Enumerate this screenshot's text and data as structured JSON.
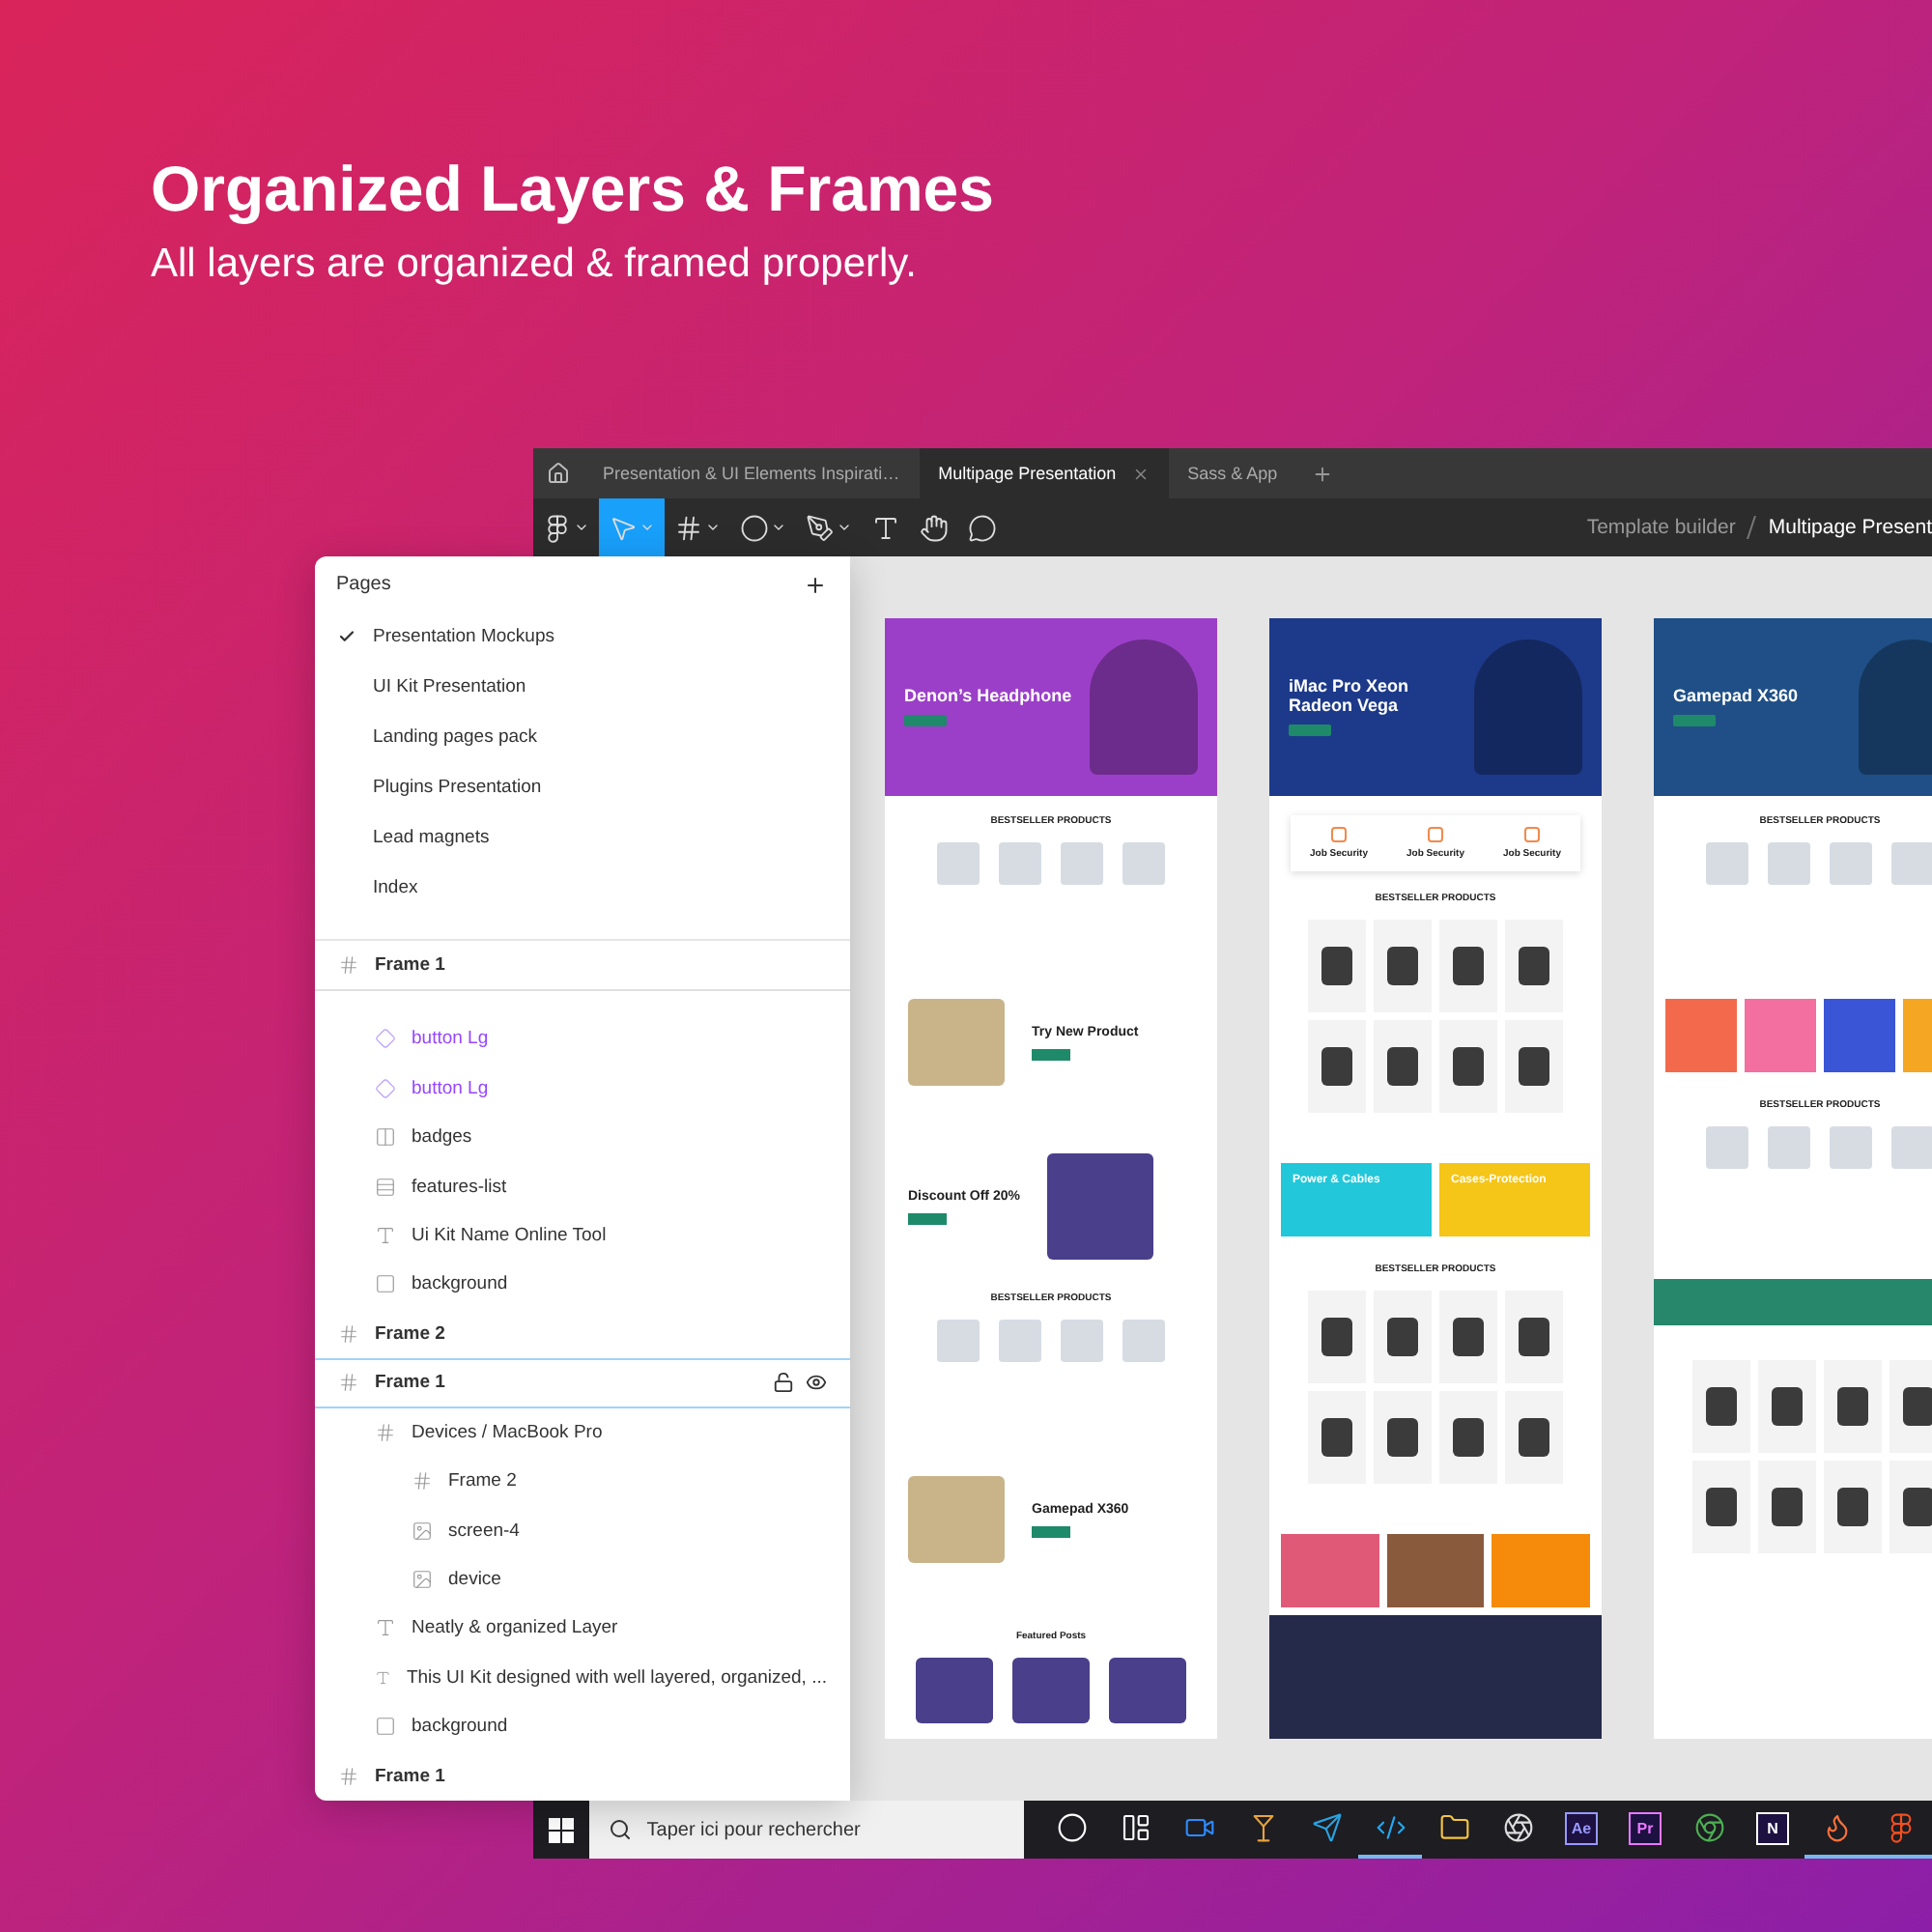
{
  "headline": {
    "title": "Organized Layers & Frames",
    "subtitle": "All layers are organized & framed properly."
  },
  "tabs": [
    {
      "label": "Presentation & UI Elements Inspirati…",
      "selected": false
    },
    {
      "label": "Multipage Presentation",
      "selected": true
    },
    {
      "label": "Sass & App",
      "selected": false
    }
  ],
  "toolbar": {
    "tools": [
      {
        "kind": "menu",
        "selected": false
      },
      {
        "kind": "move",
        "selected": true
      },
      {
        "kind": "frame",
        "selected": false
      },
      {
        "kind": "shape",
        "selected": false
      },
      {
        "kind": "pen",
        "selected": false
      },
      {
        "kind": "text",
        "selected": false
      },
      {
        "kind": "hand",
        "selected": false
      },
      {
        "kind": "comment",
        "selected": false
      }
    ],
    "breadcrumb": [
      "Template builder",
      "Multipage Present"
    ]
  },
  "pages_panel": {
    "title": "Pages",
    "pages": [
      {
        "label": "Presentation Mockups",
        "selected": true
      },
      {
        "label": "UI Kit Presentation",
        "selected": false
      },
      {
        "label": "Landing pages pack",
        "selected": false
      },
      {
        "label": "Plugins Presentation",
        "selected": false
      },
      {
        "label": "Lead magnets",
        "selected": false
      },
      {
        "label": "Index",
        "selected": false
      }
    ]
  },
  "layers": [
    {
      "name": "Frame 1",
      "kind": "frame",
      "selected": false,
      "pinned": true,
      "children": [
        {
          "name": "button Lg",
          "kind": "component",
          "selected": false
        },
        {
          "name": "button Lg",
          "kind": "component",
          "selected": false
        },
        {
          "name": "badges",
          "kind": "columns",
          "selected": false
        },
        {
          "name": "features-list",
          "kind": "rows",
          "selected": false
        },
        {
          "name": "Ui Kit Name Online Tool",
          "kind": "text",
          "selected": false
        },
        {
          "name": "background",
          "kind": "rect",
          "selected": false
        }
      ]
    },
    {
      "name": "Frame 2",
      "kind": "frame",
      "selected": false,
      "pinned": false
    },
    {
      "name": "Frame 1",
      "kind": "frame",
      "selected": true,
      "pinned": false,
      "children": [
        {
          "name": "Devices / MacBook Pro",
          "kind": "frame",
          "selected": false,
          "children": [
            {
              "name": "Frame 2",
              "kind": "frame",
              "selected": false
            },
            {
              "name": "screen-4",
              "kind": "image",
              "selected": false
            },
            {
              "name": "device",
              "kind": "image",
              "selected": false
            }
          ]
        },
        {
          "name": "Neatly & organized Layer",
          "kind": "text",
          "selected": false
        },
        {
          "name": "This UI Kit designed with well layered, organized, ...",
          "kind": "text",
          "selected": false
        },
        {
          "name": "background",
          "kind": "rect",
          "selected": false
        }
      ]
    },
    {
      "name": "Frame 1",
      "kind": "frame",
      "selected": false,
      "pinned": false
    }
  ],
  "canvas_frames": [
    {
      "sections": [
        {
          "kind": "hero",
          "title": "Denon’s Headphone",
          "color": "#9b3fc8"
        },
        {
          "kind": "products",
          "title": "BESTSELLER PRODUCTS"
        },
        {
          "kind": "feature",
          "title": "Try New Product"
        },
        {
          "kind": "promo",
          "title": "Discount Off 20%"
        },
        {
          "kind": "products",
          "title": "BESTSELLER PRODUCTS"
        },
        {
          "kind": "feature",
          "title": "Gamepad X360"
        },
        {
          "kind": "posts",
          "title": "Featured Posts"
        }
      ]
    },
    {
      "sections": [
        {
          "kind": "hero",
          "title": "iMac Pro Xeon Radeon Vega",
          "color": "#1d3a8a"
        },
        {
          "kind": "features",
          "items": [
            "Job Security",
            "Job Security",
            "Job Security"
          ]
        },
        {
          "kind": "grid",
          "title": "BESTSELLER PRODUCTS"
        },
        {
          "kind": "tiles",
          "items": [
            {
              "label": "Power & Cables",
              "color": "#22c7d9"
            },
            {
              "label": "Cases-Protection",
              "color": "#f5c518"
            }
          ]
        },
        {
          "kind": "grid",
          "title": "BESTSELLER PRODUCTS"
        },
        {
          "kind": "tiles",
          "items": [
            {
              "color": "#e05a78"
            },
            {
              "color": "#8a5a3c"
            },
            {
              "color": "#f58a0b"
            }
          ]
        },
        {
          "kind": "footer"
        }
      ]
    },
    {
      "sections": [
        {
          "kind": "hero",
          "title": "Gamepad X360",
          "color": "#1f4f86"
        },
        {
          "kind": "products",
          "title": "BESTSELLER PRODUCTS"
        },
        {
          "kind": "tiles",
          "items": [
            {
              "color": "#f26a4b"
            },
            {
              "color": "#f36fa0"
            },
            {
              "color": "#3a55d6"
            },
            {
              "color": "#f5a623"
            }
          ]
        },
        {
          "kind": "products",
          "title": "BESTSELLER PRODUCTS"
        },
        {
          "kind": "newsletter"
        },
        {
          "kind": "grid"
        }
      ]
    }
  ],
  "taskbar": {
    "search": {
      "placeholder": "Taper ici pour rechercher"
    },
    "apps": [
      {
        "kind": "circle",
        "running": false
      },
      {
        "kind": "taskview",
        "running": false
      },
      {
        "kind": "video",
        "running": false
      },
      {
        "kind": "drink",
        "running": false
      },
      {
        "kind": "send",
        "running": false
      },
      {
        "kind": "code",
        "running": true
      },
      {
        "kind": "folder",
        "running": false
      },
      {
        "kind": "aperture",
        "running": false
      },
      {
        "kind": "letters",
        "label": "Ae",
        "color": "#9999ff",
        "running": false
      },
      {
        "kind": "letters",
        "label": "Pr",
        "color": "#ea77ff",
        "running": false
      },
      {
        "kind": "browser",
        "running": false
      },
      {
        "kind": "letters",
        "label": "N",
        "color": "#ffffff",
        "running": false
      },
      {
        "kind": "flame",
        "running": true
      },
      {
        "kind": "shapes",
        "running": true
      }
    ]
  }
}
